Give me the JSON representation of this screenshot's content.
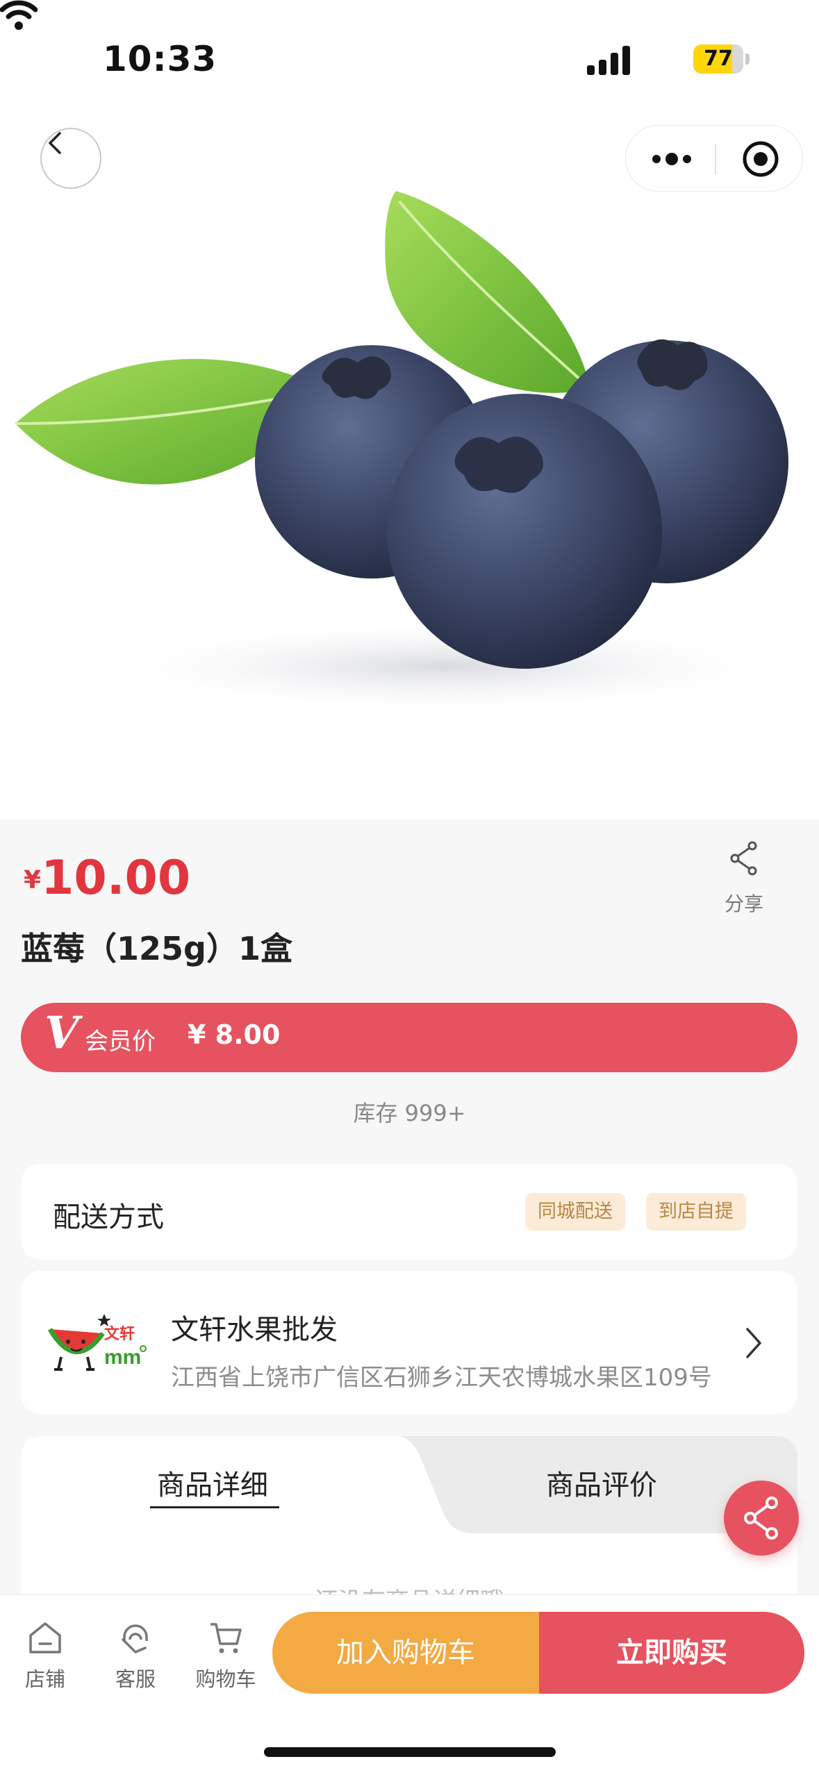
{
  "status_bar": {
    "time": "10:33",
    "battery": "77"
  },
  "product": {
    "price_symbol": "¥",
    "price": "10.00",
    "title": "蓝莓（125g）1盒",
    "share_label": "分享"
  },
  "member": {
    "badge": "V",
    "label": "会员价",
    "price": "¥ 8.00"
  },
  "stock": "库存 999+",
  "delivery": {
    "title": "配送方式",
    "options": [
      "同城配送",
      "到店自提"
    ]
  },
  "store": {
    "logo_text": "文轩",
    "name": "文轩水果批发",
    "address": "江西省上饶市广信区石狮乡江天农博城水果区109号"
  },
  "tabs": {
    "detail": "商品详细",
    "review": "商品评价",
    "empty_detail": "还没有商品详细哦"
  },
  "bottom_bar": {
    "shop": "店铺",
    "service": "客服",
    "cart": "购物车",
    "add_to_cart": "加入购物车",
    "buy_now": "立即购买"
  },
  "colors": {
    "accent_red": "#e6525f",
    "price_red": "#e2363f",
    "cart_orange": "#f3aa42",
    "tag_bg": "#fcebd7"
  }
}
